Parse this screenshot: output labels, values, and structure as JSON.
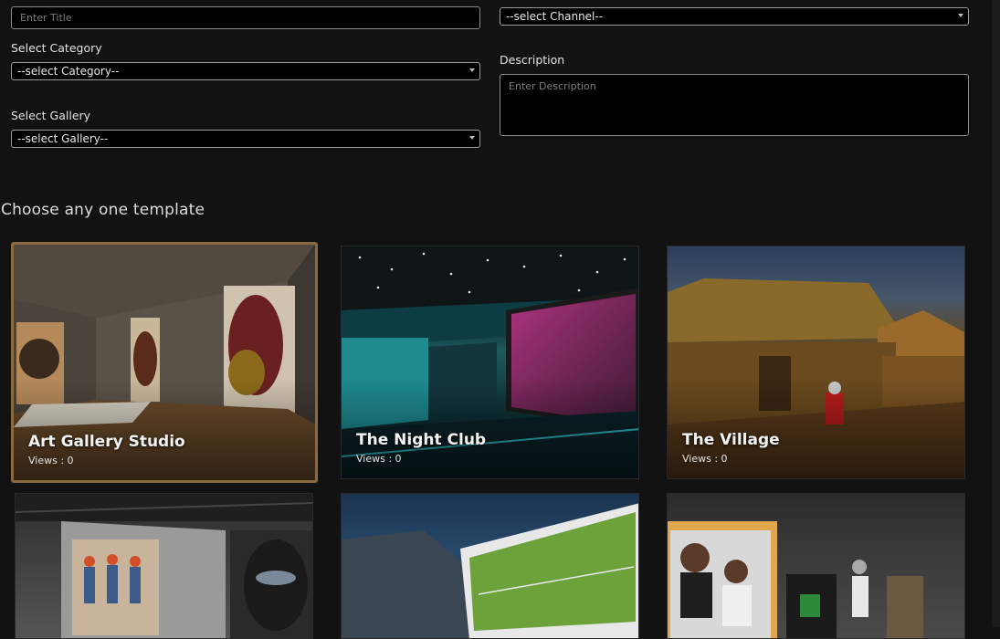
{
  "form": {
    "title_placeholder": "Enter Title",
    "channel_select": "--select Channel--",
    "category_label": "Select Category",
    "category_select": "--select Category--",
    "description_label": "Description",
    "description_placeholder": "Enter Description",
    "gallery_label": "Select Gallery",
    "gallery_select": "--select Gallery--"
  },
  "templates": {
    "heading": "Choose any one template",
    "cards": [
      {
        "title": "Art Gallery Studio",
        "views": "Views : 0",
        "selected": true
      },
      {
        "title": "The Night Club",
        "views": "Views : 0",
        "selected": false
      },
      {
        "title": "The Village",
        "views": "Views : 0",
        "selected": false
      },
      {
        "title": "",
        "views": "",
        "selected": false
      },
      {
        "title": "",
        "views": "",
        "selected": false
      },
      {
        "title": "",
        "views": "",
        "selected": false
      }
    ]
  },
  "colors": {
    "background": "#121212",
    "selected_border": "#8a6a3e"
  }
}
